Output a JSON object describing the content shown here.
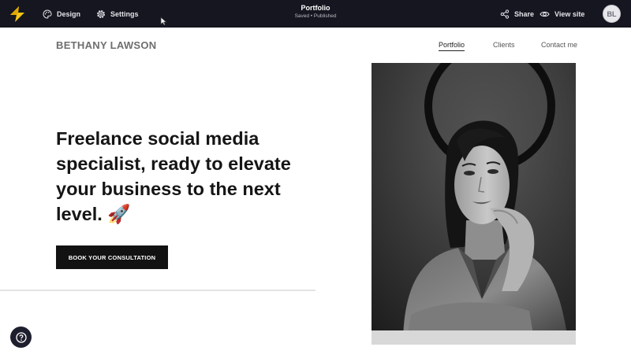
{
  "topbar": {
    "logo_icon": "lightning-logo-icon",
    "design_label": "Design",
    "settings_label": "Settings",
    "title": "Portfolio",
    "status": "Saved • Published",
    "share_label": "Share",
    "view_site_label": "View site",
    "avatar_initials": "BL"
  },
  "site": {
    "name": "BETHANY LAWSON",
    "nav": [
      "Portfolio",
      "Clients",
      "Contact me"
    ],
    "active_nav": "Portfolio"
  },
  "hero": {
    "headline": "Freelance social media specialist, ready to elevate your business to the next level.",
    "headline_emoji": "🚀",
    "cta_label": "BOOK YOUR CONSULTATION"
  },
  "colors": {
    "topbar_bg": "#15161f",
    "logo_yellow": "#f5c518",
    "cta_bg": "#121212"
  }
}
